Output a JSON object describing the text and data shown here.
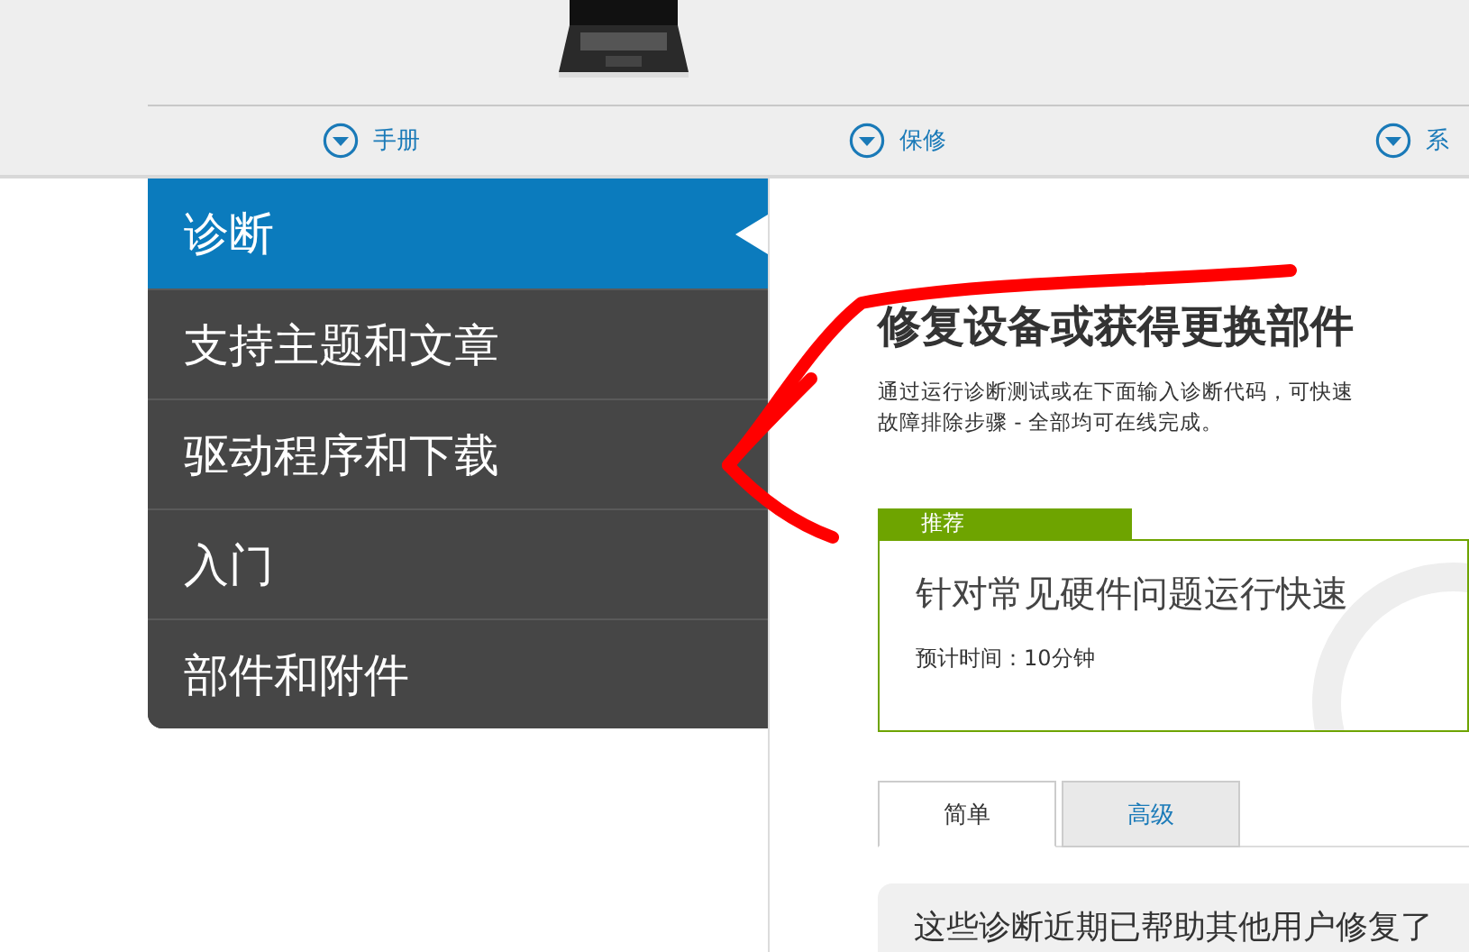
{
  "header_nav": [
    {
      "label": "手册"
    },
    {
      "label": "保修"
    },
    {
      "label": "系"
    }
  ],
  "sidebar": {
    "items": [
      {
        "label": "诊断",
        "selected": true
      },
      {
        "label": "支持主题和文章",
        "selected": false
      },
      {
        "label": "驱动程序和下载",
        "selected": false
      },
      {
        "label": "入门",
        "selected": false
      },
      {
        "label": "部件和附件",
        "selected": false
      }
    ]
  },
  "main": {
    "title": "修复设备或获得更换部件",
    "description_lines": [
      "通过运行诊断测试或在下面输入诊断代码，可快速",
      "故障排除步骤 - 全部均可在线完成。"
    ],
    "recommended": {
      "badge": "推荐",
      "title": "针对常见硬件问题运行快速",
      "time": "预计时间：10分钟"
    },
    "tabs": [
      {
        "label": "简单",
        "selected": true
      },
      {
        "label": "高级",
        "selected": false
      }
    ],
    "panel_text": "这些诊断近期已帮助其他用户修复了"
  }
}
